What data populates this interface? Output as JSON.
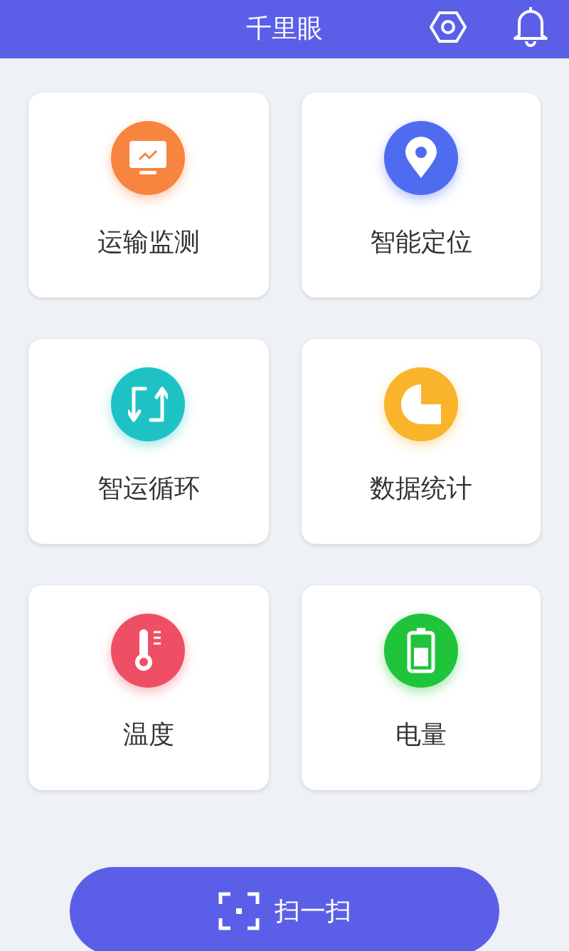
{
  "header": {
    "title": "千里眼"
  },
  "tiles": [
    {
      "label": "运输监测",
      "kind": "monitor",
      "color": "#f7843f"
    },
    {
      "label": "智能定位",
      "kind": "pin",
      "color": "#4f6cf0"
    },
    {
      "label": "智运循环",
      "kind": "cycle",
      "color": "#1fc2c4"
    },
    {
      "label": "数据统计",
      "kind": "chart",
      "color": "#f9b42c"
    },
    {
      "label": "温度",
      "kind": "thermometer",
      "color": "#ef4f64"
    },
    {
      "label": "电量",
      "kind": "battery",
      "color": "#1fc43a"
    }
  ],
  "scan_button": {
    "label": "扫一扫"
  }
}
